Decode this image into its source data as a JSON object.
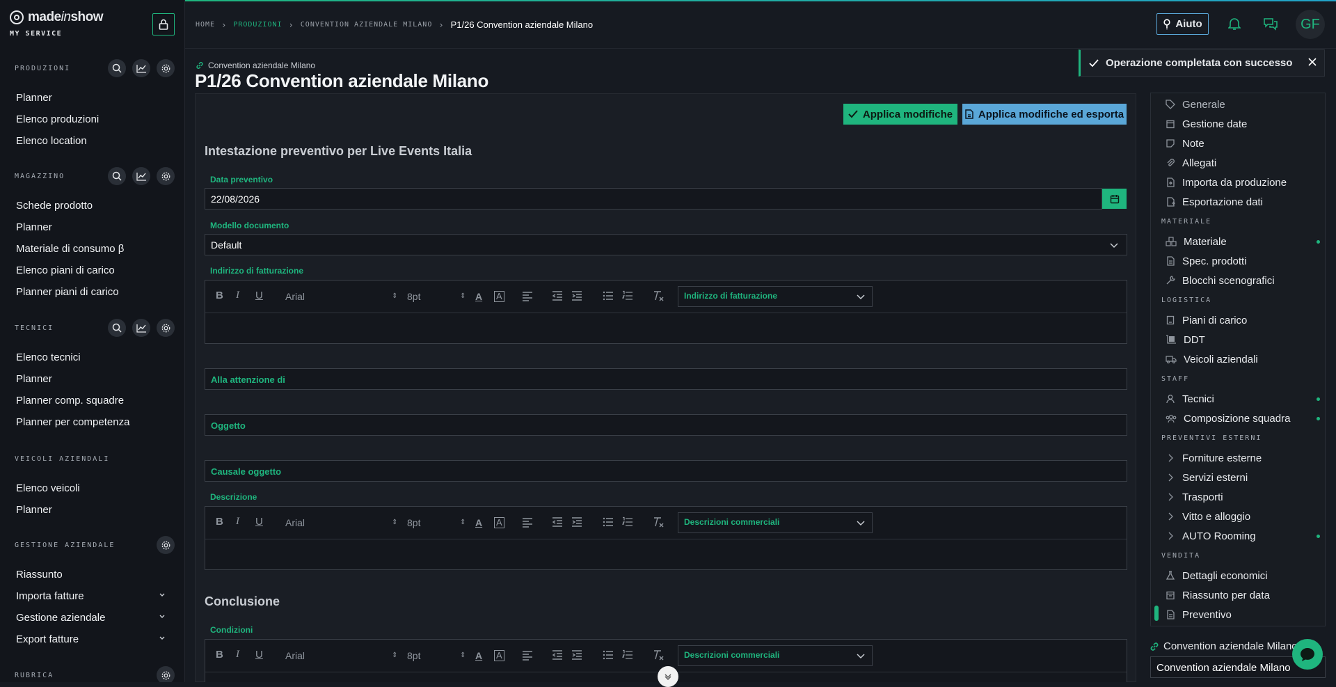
{
  "brand": {
    "name_a": "made",
    "name_b": "in",
    "name_c": "show",
    "subtitle": "MY SERVICE"
  },
  "sidebar": {
    "sections": [
      {
        "title": "PRODUZIONI",
        "items": [
          "Planner",
          "Elenco produzioni",
          "Elenco location"
        ]
      },
      {
        "title": "MAGAZZINO",
        "items": [
          "Schede prodotto",
          "Planner",
          "Materiale di consumo β",
          "Elenco piani di carico",
          "Planner piani di carico"
        ]
      },
      {
        "title": "TECNICI",
        "items": [
          "Elenco tecnici",
          "Planner",
          "Planner comp. squadre",
          "Planner per competenza"
        ]
      },
      {
        "title": "VEICOLI AZIENDALI",
        "items": [
          "Elenco veicoli",
          "Planner"
        ]
      },
      {
        "title": "GESTIONE AZIENDALE",
        "items": [
          "Riassunto",
          "Importa fatture",
          "Gestione aziendale",
          "Export fatture"
        ]
      },
      {
        "title": "RUBRICA",
        "items": []
      }
    ]
  },
  "breadcrumb": {
    "home": "HOME",
    "produzioni": "PRODUZIONI",
    "convention": "CONVENTION AZIENDALE MILANO",
    "current": "P1/26 Convention aziendale Milano"
  },
  "header": {
    "help_label": "Aiuto",
    "avatar_initials": "GF"
  },
  "toast": {
    "message": "Operazione completata con successo"
  },
  "page": {
    "production_link": "Convention aziendale Milano",
    "title": "P1/26 Convention aziendale Milano"
  },
  "actions": {
    "apply": "Applica modifiche",
    "apply_export": "Applica modifiche ed esporta"
  },
  "form": {
    "heading": "Intestazione preventivo per Live Events Italia",
    "date_label": "Data preventivo",
    "date_value": "22/08/2026",
    "model_label": "Modello documento",
    "model_value": "Default",
    "billing_label": "Indirizzo di fatturazione",
    "billing_template": "Indirizzo di fatturazione",
    "attention_label": "Alla attenzione di",
    "subject_label": "Oggetto",
    "subject_reason_label": "Causale oggetto",
    "description_label": "Descrizione",
    "description_template": "Descrizioni commerciali",
    "conclusion_heading": "Conclusione",
    "conditions_label": "Condizioni",
    "conditions_template": "Descrizioni commerciali",
    "font_name": "Arial",
    "font_size": "8pt"
  },
  "right_nav": {
    "items": [
      {
        "label": "Generale",
        "icon": "tag-icon",
        "dim": true
      },
      {
        "label": "Gestione date",
        "icon": "calendar-icon"
      },
      {
        "label": "Note",
        "icon": "note-icon"
      },
      {
        "label": "Allegati",
        "icon": "paperclip-icon"
      },
      {
        "label": "Importa da produzione",
        "icon": "file-import-icon"
      },
      {
        "label": "Esportazione dati",
        "icon": "file-export-icon"
      }
    ],
    "cat_materiale": "MATERIALE",
    "materiale": [
      "Materiale",
      "Spec. prodotti",
      "Blocchi scenografici"
    ],
    "cat_logistica": "LOGISTICA",
    "logistica": [
      "Piani di carico",
      "DDT",
      "Veicoli aziendali"
    ],
    "cat_staff": "STAFF",
    "staff": [
      "Tecnici",
      "Composizione squadra"
    ],
    "cat_preventivi": "PREVENTIVI ESTERNI",
    "preventivi": [
      "Forniture esterne",
      "Servizi esterni",
      "Trasporti",
      "Vitto e alloggio",
      "AUTO Rooming"
    ],
    "cat_vendita": "VENDITA",
    "vendita": [
      "Dettagli economici",
      "Riassunto per data",
      "Preventivo"
    ],
    "link_label": "Convention aziendale Milano",
    "input_value": "Convention aziendale Milano"
  },
  "colors": {
    "accent": "#1fb57e",
    "secondary": "#5aa7d8",
    "background": "#161a21"
  }
}
